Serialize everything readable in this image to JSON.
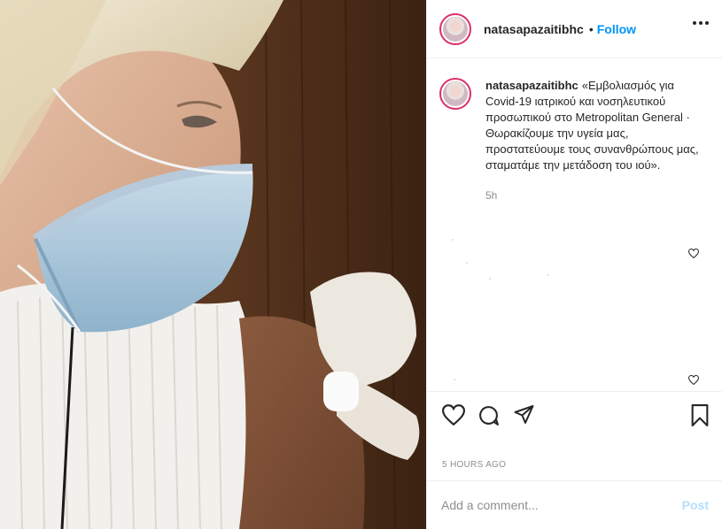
{
  "post": {
    "username": "natasapazaitibhc",
    "separator": "•",
    "follow_label": "Follow",
    "caption": "«Εμβολιασμός για Covid-19 ιατρικού και νοσηλευτικού προσωπικού στο Metropolitan General · Θωρακίζουμε την υγεία μας, προστατεύουμε τους συνανθρώπους μας, σταματάμε την μετάδοση του ιού».",
    "caption_age": "5h",
    "timestamp": "5 HOURS AGO"
  },
  "comment": {
    "placeholder": "Add a comment...",
    "post_label": "Post"
  },
  "icons": {
    "more": "more-options-icon",
    "like": "heart-icon",
    "comment": "comment-bubble-icon",
    "share": "paper-plane-icon",
    "save": "bookmark-icon"
  },
  "colors": {
    "follow": "#0095f6",
    "post_disabled": "#b2dffc",
    "avatar_ring": "#dc2f6a",
    "muted": "#8e8e8e"
  }
}
